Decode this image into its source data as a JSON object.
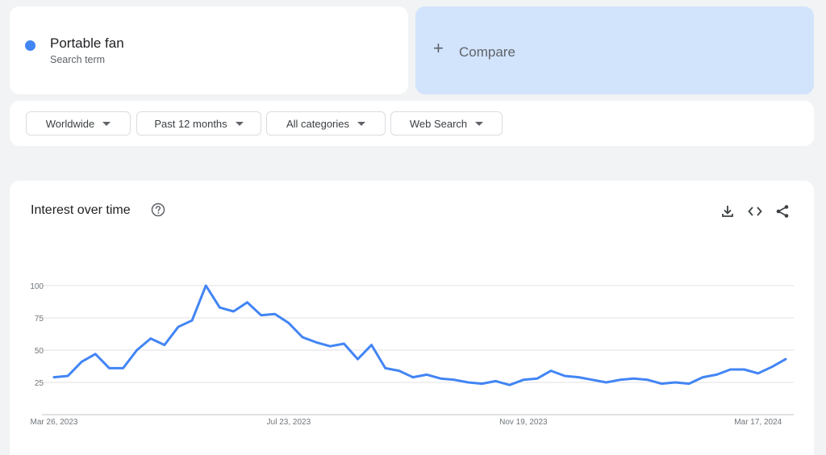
{
  "search_term": {
    "name": "Portable fan",
    "subtitle": "Search term",
    "color": "#4285f4"
  },
  "compare": {
    "icon": "plus-icon",
    "label": "Compare"
  },
  "filters": [
    {
      "label": "Worldwide"
    },
    {
      "label": "Past 12 months"
    },
    {
      "label": "All categories"
    },
    {
      "label": "Web Search"
    }
  ],
  "chart_panel": {
    "title": "Interest over time",
    "icons": [
      "help-icon",
      "download-icon",
      "embed-icon",
      "share-icon"
    ]
  },
  "chart_data": {
    "type": "line",
    "title": "Interest over time",
    "xlabel": "",
    "ylabel": "",
    "ylim": [
      0,
      100
    ],
    "y_ticks": [
      25,
      50,
      75,
      100
    ],
    "x_tick_labels": [
      "Mar 26, 2023",
      "Jul 23, 2023",
      "Nov 19, 2023",
      "Mar 17, 2024"
    ],
    "x_tick_indices": [
      0,
      17,
      34,
      51
    ],
    "grid": true,
    "series": [
      {
        "color": "#4285f4",
        "values": [
          29,
          30,
          41,
          47,
          36,
          36,
          50,
          59,
          54,
          68,
          73,
          100,
          83,
          80,
          87,
          77,
          78,
          71,
          60,
          56,
          53,
          55,
          43,
          54,
          36,
          34,
          29,
          31,
          28,
          27,
          25,
          24,
          26,
          23,
          27,
          28,
          34,
          30,
          29,
          27,
          25,
          27,
          28,
          27,
          24,
          25,
          24,
          29,
          31,
          35,
          35,
          32,
          37,
          43
        ]
      }
    ]
  }
}
